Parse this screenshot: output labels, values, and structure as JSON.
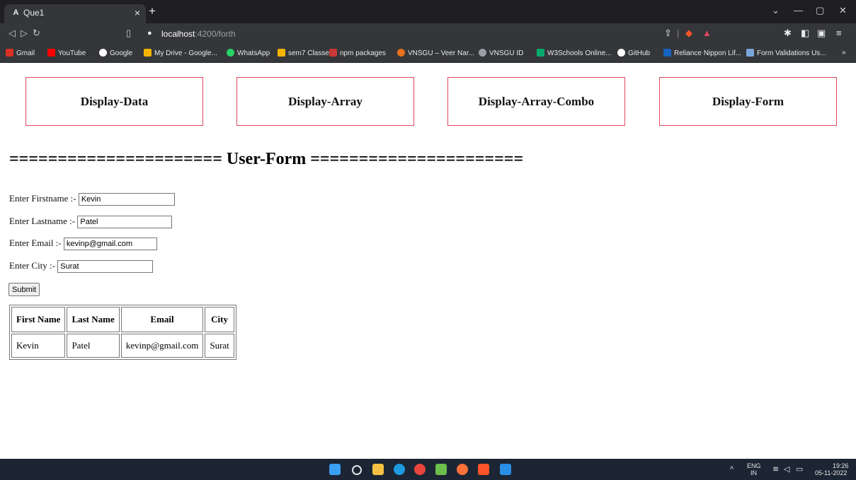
{
  "browser": {
    "tab_title": "Que1",
    "tab_close": "×",
    "new_tab": "+",
    "url_host": "localhost",
    "url_path": ":4200/forth",
    "bookmarks": [
      "Gmail",
      "YouTube",
      "Google",
      "My Drive - Google...",
      "WhatsApp",
      "sem7 Classes",
      "npm packages",
      "VNSGU – Veer Nar...",
      "VNSGU ID",
      "W3Schools Online...",
      "GitHub",
      "Reliance Nippon Lif...",
      "Form Validations Us..."
    ],
    "bookmark_more": "»"
  },
  "nav": {
    "display_data": "Display-Data",
    "display_array": "Display-Array",
    "display_array_combo": "Display-Array-Combo",
    "display_form": "Display-Form"
  },
  "heading": "====================== User-Form ======================",
  "form": {
    "firstname_label": "Enter Firstname :-",
    "firstname_value": "Kevin",
    "lastname_label": "Enter Lastname :-",
    "lastname_value": "Patel",
    "email_label": "Enter Email :-",
    "email_value": "kevinp@gmail.com",
    "city_label": "Enter City :-",
    "city_value": "Surat",
    "submit_label": "Submit"
  },
  "table": {
    "headers": [
      "First Name",
      "Last Name",
      "Email",
      "City"
    ],
    "rows": [
      [
        "Kevin",
        "Patel",
        "kevinp@gmail.com",
        "Surat"
      ]
    ]
  },
  "taskbar": {
    "lang_top": "ENG",
    "lang_bottom": "IN",
    "time": "19:26",
    "date": "05-11-2022"
  }
}
